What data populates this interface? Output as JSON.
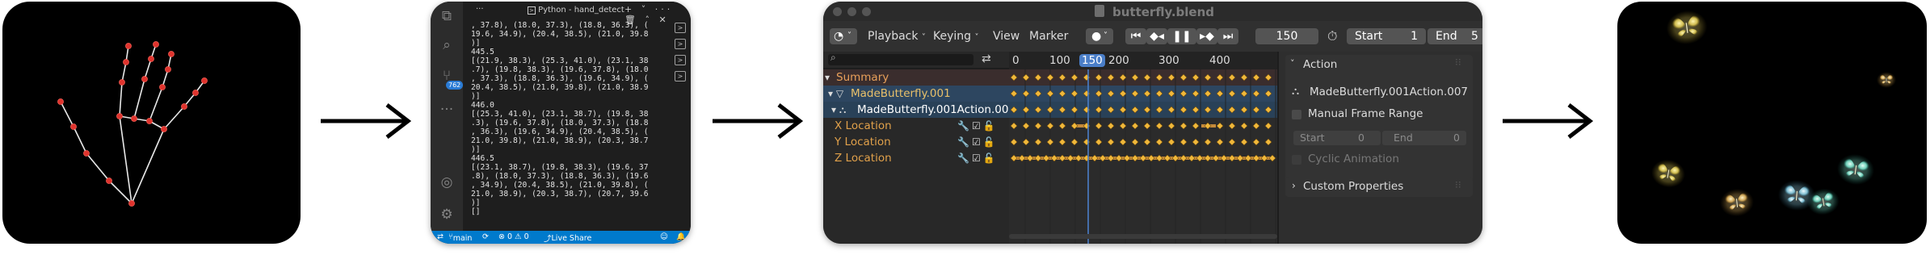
{
  "arrows": [
    "right-arrow",
    "right-arrow",
    "right-arrow"
  ],
  "vscode": {
    "title_dots": "···",
    "title": "Python - hand_detect",
    "title_actions": "+ ˅ ··· 🗑 ˄ ✕",
    "badge": "762",
    "terminal_lines": [
      ", 37.8), (18.0, 37.3), (18.8, 36.3), (",
      "19.6, 34.9), (20.4, 38.5), (21.0, 39.8",
      ")]",
      "445.5",
      "[(21.9, 38.3), (25.3, 41.0), (23.1, 38",
      ".7), (19.8, 38.3), (19.6, 37.8), (18.0",
      ", 37.3), (18.8, 36.3), (19.6, 34.9), (",
      "20.4, 38.5), (21.0, 39.8), (21.0, 38.9",
      ")]",
      "446.0",
      "[(25.3, 41.0), (23.1, 38.7), (19.8, 38",
      ".3), (19.6, 37.8), (18.0, 37.3), (18.8",
      ", 36.3), (19.6, 34.9), (20.4, 38.5), (",
      "21.0, 39.8), (21.0, 38.9), (20.3, 38.7",
      ")]",
      "446.5",
      "[(23.1, 38.7), (19.8, 38.3), (19.6, 37",
      ".8), (18.0, 37.3), (18.8, 36.3), (19.6",
      ", 34.9), (20.4, 38.5), (21.0, 39.8), (",
      "21.0, 38.9), (20.3, 38.7), (20.7, 39.6",
      ")]",
      "[]"
    ],
    "status": {
      "branch": "main",
      "sync": "⟳",
      "problems": "⊗ 0 ⚠ 0",
      "live_share": "Live Share"
    }
  },
  "blender": {
    "title": "butterfly.blend",
    "menu": {
      "playback": "Playback",
      "keying": "Keying",
      "view": "View",
      "marker": "Marker"
    },
    "current_frame": "150",
    "start_label": "Start",
    "start_value": "1",
    "end_label": "End",
    "end_value": "5",
    "ruler_ticks": [
      "0",
      "100",
      "150",
      "200",
      "300",
      "400"
    ],
    "channels": [
      {
        "label": "Summary",
        "color": "#e8a05a"
      },
      {
        "label": "MadeButterfly.001",
        "color": "#e8c06a"
      },
      {
        "label": "MadeButterfly.001Action.007",
        "color": "#ffffff"
      },
      {
        "label": "X Location",
        "color": "#e0a04a"
      },
      {
        "label": "Y Location",
        "color": "#e0a04a"
      },
      {
        "label": "Z Location",
        "color": "#e0a04a"
      }
    ],
    "action_panel": {
      "header": "Action",
      "action_name": "MadeButterfly.001Action.007",
      "manual_frame_range": "Manual Frame Range",
      "start_label": "Start",
      "start_value": "0",
      "end_label": "End",
      "end_value": "0",
      "cyclic": "Cyclic Animation",
      "custom_props": "Custom Properties"
    }
  }
}
